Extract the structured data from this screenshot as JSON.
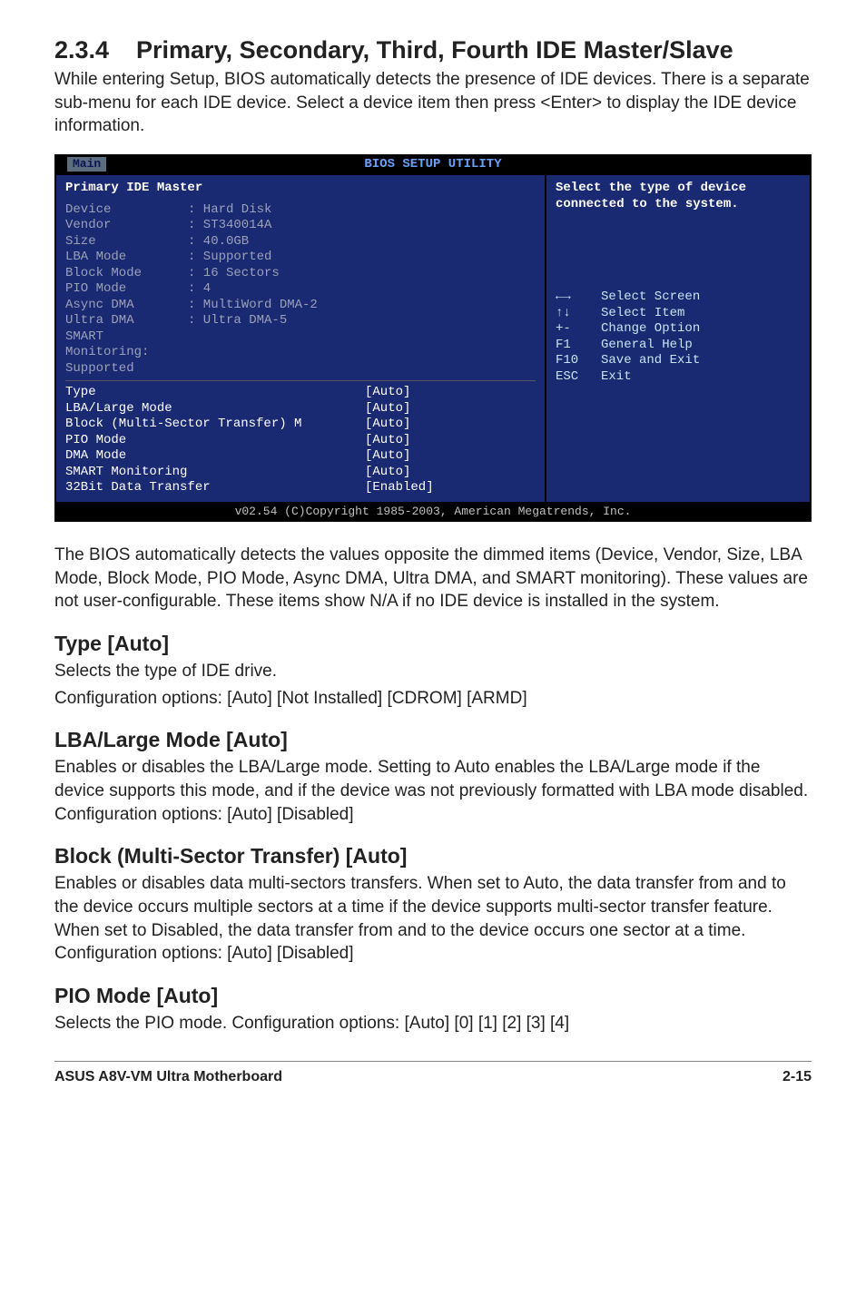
{
  "section": {
    "number": "2.3.4",
    "title": "Primary, Secondary, Third, Fourth IDE Master/Slave",
    "intro": "While entering Setup, BIOS automatically detects the presence of IDE devices. There is a separate sub-menu for each IDE device. Select a device item then press <Enter> to display the IDE device information."
  },
  "bios": {
    "header": "BIOS SETUP UTILITY",
    "tab": "Main",
    "panel_title": "Primary IDE Master",
    "dimmed": [
      {
        "label": "Device",
        "value": ": Hard Disk"
      },
      {
        "label": "Vendor",
        "value": ": ST340014A"
      },
      {
        "label": "Size",
        "value": ": 40.0GB"
      },
      {
        "label": "LBA Mode",
        "value": ": Supported"
      },
      {
        "label": "Block Mode",
        "value": ": 16 Sectors"
      },
      {
        "label": "PIO Mode",
        "value": ": 4"
      },
      {
        "label": "Async DMA",
        "value": ": MultiWord DMA-2"
      },
      {
        "label": "Ultra DMA",
        "value": ": Ultra DMA-5"
      },
      {
        "label": "SMART Monitoring: Supported",
        "value": ""
      }
    ],
    "items": [
      {
        "label": "Type",
        "value": "[Auto]"
      },
      {
        "label": "LBA/Large Mode",
        "value": "[Auto]"
      },
      {
        "label": "Block (Multi-Sector Transfer) M",
        "value": "[Auto]"
      },
      {
        "label": "PIO Mode",
        "value": "[Auto]"
      },
      {
        "label": "DMA Mode",
        "value": "[Auto]"
      },
      {
        "label": "SMART Monitoring",
        "value": "[Auto]"
      },
      {
        "label": "32Bit Data Transfer",
        "value": "[Enabled]"
      }
    ],
    "help_top": "Select the type of device connected to the system.",
    "help_keys": [
      {
        "k": "←→",
        "d": "Select Screen"
      },
      {
        "k": "↑↓",
        "d": "Select Item"
      },
      {
        "k": "+-",
        "d": "Change Option"
      },
      {
        "k": "F1",
        "d": "General Help"
      },
      {
        "k": "F10",
        "d": "Save and Exit"
      },
      {
        "k": "ESC",
        "d": "Exit"
      }
    ],
    "footer": "v02.54 (C)Copyright 1985-2003, American Megatrends, Inc."
  },
  "after_bios_p1": "The BIOS automatically detects the values opposite the dimmed items (Device, Vendor, Size, LBA Mode, Block Mode, PIO Mode, Async DMA, Ultra DMA, and SMART monitoring). These values are not user-configurable. These items show  N/A if no IDE device is installed in the system.",
  "type": {
    "h": "Type [Auto]",
    "p1": "Selects the type of IDE drive.",
    "p2": "Configuration options: [Auto] [Not Installed] [CDROM] [ARMD]"
  },
  "lba": {
    "h": "LBA/Large Mode [Auto]",
    "p": "Enables or disables the LBA/Large mode. Setting to Auto enables the LBA/Large mode if the device supports this mode, and if the device was not previously formatted with LBA mode disabled. Configuration options: [Auto] [Disabled]"
  },
  "block": {
    "h": "Block (Multi-Sector Transfer) [Auto]",
    "p": "Enables or disables data multi-sectors transfers. When set to Auto, the data transfer from and to the device occurs multiple sectors at a time if the device supports multi-sector transfer feature. When set to Disabled, the data transfer from and to the device occurs one sector at a time. Configuration options: [Auto] [Disabled]"
  },
  "pio": {
    "h": "PIO Mode [Auto]",
    "p": "Selects the PIO mode. Configuration options: [Auto] [0] [1] [2] [3] [4]"
  },
  "footer": {
    "left": "ASUS A8V-VM Ultra Motherboard",
    "right": "2-15"
  }
}
